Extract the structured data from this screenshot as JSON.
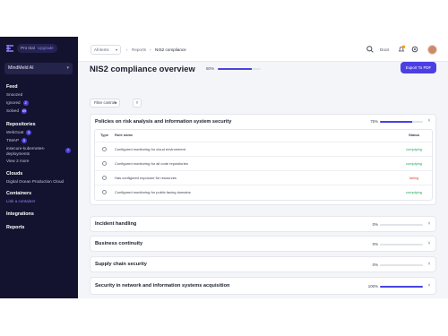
{
  "sidebar": {
    "plan": "Pro trial",
    "upgrade": "Upgrade",
    "workspace": "MindMeld AI",
    "sections": [
      {
        "heading": "Feed",
        "items": [
          {
            "label": "Snoozed",
            "count": ""
          },
          {
            "label": "Ignored",
            "count": "2"
          },
          {
            "label": "Solved",
            "count": "69"
          }
        ]
      },
      {
        "heading": "Repositories",
        "items": [
          {
            "label": "WebGoat",
            "count": "5"
          },
          {
            "label": "TIMAP",
            "count": "5"
          },
          {
            "label": "insecure-kubernetes-",
            "count": "7"
          },
          {
            "label": "deployments",
            "count": ""
          },
          {
            "label": "View 2 more",
            "count": ""
          }
        ]
      },
      {
        "heading": "Clouds",
        "items": [
          {
            "label": "Digital Ocean Production Cloud",
            "count": ""
          }
        ]
      },
      {
        "heading": "Containers",
        "items": [
          {
            "label": "Link a container",
            "count": ""
          }
        ]
      },
      {
        "heading": "Integrations",
        "items": []
      },
      {
        "heading": "Reports",
        "items": []
      }
    ]
  },
  "topbar": {
    "all_items": "All items",
    "breadcrumb": [
      "Reports",
      "NIS2 compliance"
    ],
    "docs": "Docs",
    "notif_count": "8"
  },
  "page": {
    "title": "NIS2 compliance overview",
    "progress_pct": 80,
    "progress_label": "80%",
    "export_label": "Export To PDF",
    "filter_label": "Filter controls"
  },
  "expanded": {
    "title": "Policies on risk analysis and information system security",
    "pct": 75,
    "pct_label": "75%",
    "col_type": "Type",
    "col_rule": "Rule name",
    "col_status": "Status",
    "rows": [
      {
        "name": "Configured monitoring for cloud environment",
        "status": "complying"
      },
      {
        "name": "Configured monitoring for all code repositories",
        "status": "complying"
      },
      {
        "name": "Has configured exposure for resources",
        "status": "failing"
      },
      {
        "name": "Configured monitoring for public facing domains",
        "status": "complying"
      }
    ]
  },
  "sections": [
    {
      "title": "Incident handling",
      "pct": 0,
      "pct_label": "0%"
    },
    {
      "title": "Business continuity",
      "pct": 0,
      "pct_label": "0%"
    },
    {
      "title": "Supply chain security",
      "pct": 0,
      "pct_label": "0%"
    },
    {
      "title": "Security in network and information systems acquisition",
      "pct": 100,
      "pct_label": "100%"
    }
  ],
  "colors": {
    "sidebar_bg": "#14132f",
    "accent": "#4b3fe3",
    "complying": "#1ea85a",
    "failing": "#e0443a"
  },
  "icons": [
    "logo-icon",
    "search-icon",
    "bell-icon",
    "gear-icon",
    "filter-icon",
    "chevron-down-icon",
    "chevron-up-icon",
    "rule-icon"
  ]
}
